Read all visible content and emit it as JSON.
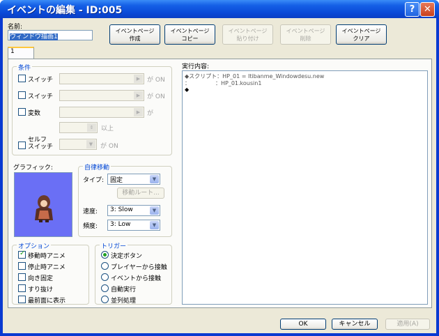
{
  "window": {
    "title": "イベントの編集 - ID:005",
    "help_label": "?",
    "close_label": "✕"
  },
  "name": {
    "label": "名前:",
    "value": "ウィンドウ描画1"
  },
  "page_buttons": {
    "create": "イベントページ\n作成",
    "copy": "イベントページ\nコピー",
    "paste": "イベントページ\n貼り付け",
    "delete": "イベントページ\n削除",
    "clear": "イベントページ\nクリア"
  },
  "tab_label": "1",
  "conditions": {
    "title": "条件",
    "switch1_label": "スイッチ",
    "switch1_suffix": "が ON",
    "switch2_label": "スイッチ",
    "switch2_suffix": "が ON",
    "variable_label": "変数",
    "variable_suffix": "が",
    "variable_min_suffix": "以上",
    "self_switch_label": "セルフ\nスイッチ",
    "self_switch_suffix": "が ON"
  },
  "graphic_label": "グラフィック:",
  "autonomous": {
    "title": "自律移動",
    "type_label": "タイプ:",
    "type_value": "固定",
    "route_button": "移動ルート...",
    "speed_label": "速度:",
    "speed_value": "3: Slow",
    "freq_label": "頻度:",
    "freq_value": "3: Low"
  },
  "options": {
    "title": "オプション",
    "items": [
      {
        "label": "移動時アニメ",
        "checked": true
      },
      {
        "label": "停止時アニメ",
        "checked": false
      },
      {
        "label": "向き固定",
        "checked": false
      },
      {
        "label": "すり抜け",
        "checked": false
      },
      {
        "label": "最前面に表示",
        "checked": false
      }
    ]
  },
  "trigger": {
    "title": "トリガー",
    "items": [
      {
        "label": "決定ボタン",
        "checked": true
      },
      {
        "label": "プレイヤーから接触",
        "checked": false
      },
      {
        "label": "イベントから接触",
        "checked": false
      },
      {
        "label": "自動実行",
        "checked": false
      },
      {
        "label": "並列処理",
        "checked": false
      }
    ]
  },
  "contents": {
    "label": "実行内容:",
    "lines": [
      "◆スクリプト：HP_01 = Itibanme_Windowdesu.new",
      "：　　　　　：HP_01.kousin1",
      "◆"
    ]
  },
  "footer": {
    "ok": "OK",
    "cancel": "キャンセル",
    "apply": "適用(A)"
  },
  "colors": {
    "title_bar": "#0a4ad8",
    "dialog_bg": "#ece9d8",
    "group_title": "#0046d5",
    "graphic_bg": "#6a6ff5"
  }
}
